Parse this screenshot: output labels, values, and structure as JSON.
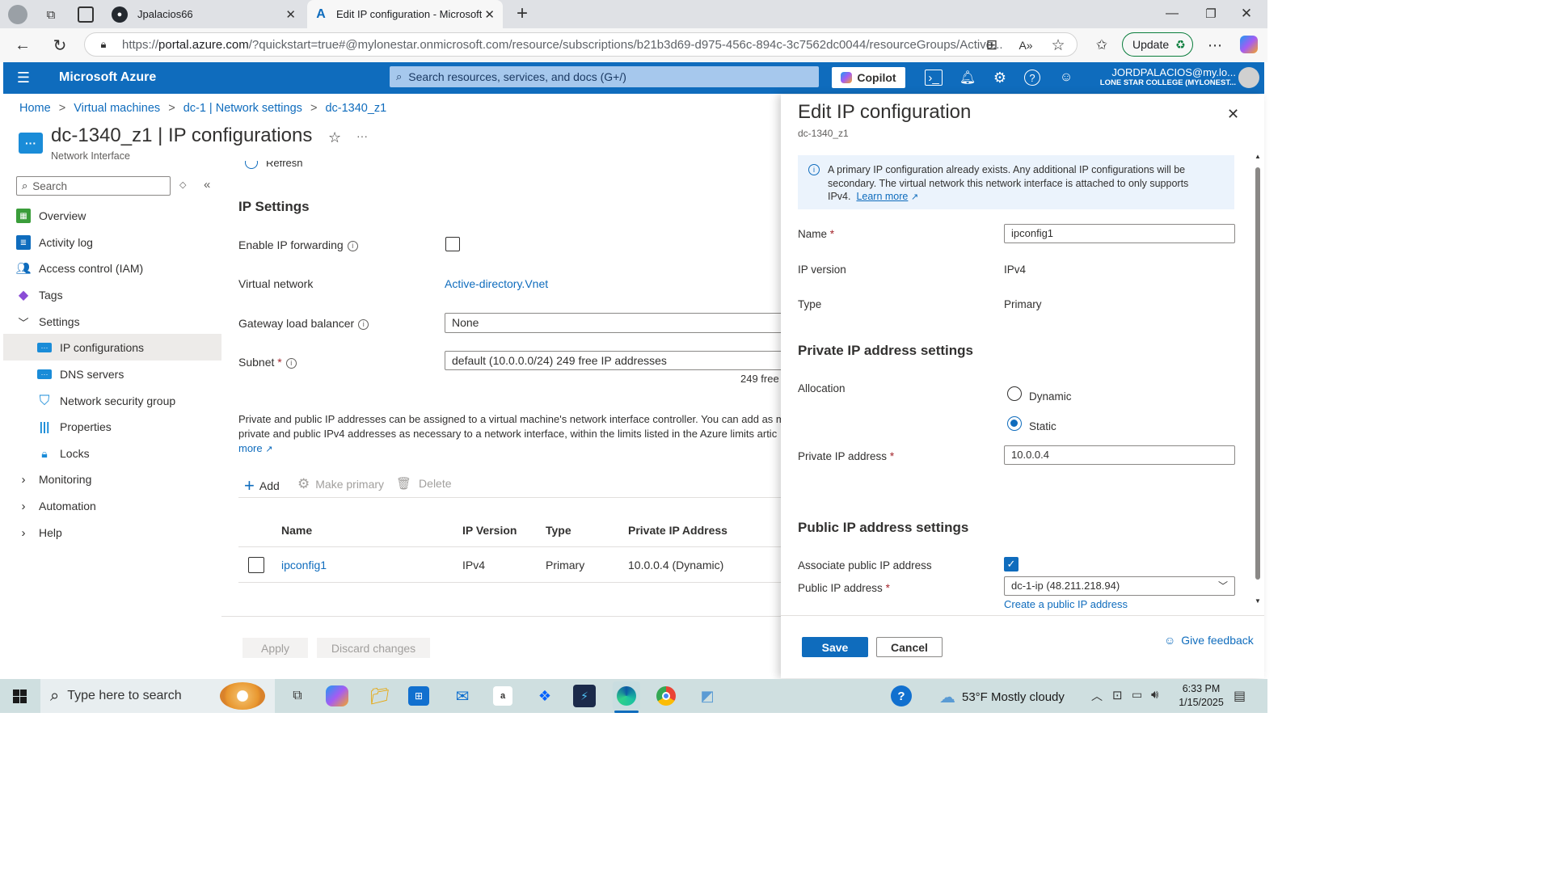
{
  "browser": {
    "tabs": [
      {
        "title": "Jpalacios66"
      },
      {
        "title": "Edit IP configuration - Microsoft A"
      }
    ],
    "url_prefix": "https://",
    "url_domain": "portal.azure.com",
    "url_rest": "/?quickstart=true#@mylonestar.onmicrosoft.com/resource/subscriptions/b21b3d69-d975-456c-894c-3c7562dc0044/resourceGroups/Active...",
    "update_label": "Update"
  },
  "azure_bar": {
    "brand": "Microsoft Azure",
    "search_placeholder": "Search resources, services, and docs (G+/)",
    "copilot_label": "Copilot",
    "user_name": "JORDPALACIOS@my.lo...",
    "user_org": "LONE STAR COLLEGE (MYLONEST..."
  },
  "breadcrumb": [
    "Home",
    "Virtual machines",
    "dc-1 | Network settings",
    "dc-1340_z1"
  ],
  "breadcrumb_sep": ">",
  "page": {
    "title": "dc-1340_z1 | IP configurations",
    "subtitle": "Network Interface",
    "more": "···"
  },
  "sidebar": {
    "search_placeholder": "Search",
    "items": [
      {
        "label": "Overview",
        "icon": "overview-icon"
      },
      {
        "label": "Activity log",
        "icon": "activity-log-icon"
      },
      {
        "label": "Access control (IAM)",
        "icon": "iam-icon"
      },
      {
        "label": "Tags",
        "icon": "tag-icon"
      },
      {
        "label": "Settings",
        "icon": "chevron-down-icon"
      },
      {
        "label": "IP configurations",
        "icon": "nic-icon"
      },
      {
        "label": "DNS servers",
        "icon": "dns-icon"
      },
      {
        "label": "Network security group",
        "icon": "shield-icon"
      },
      {
        "label": "Properties",
        "icon": "properties-icon"
      },
      {
        "label": "Locks",
        "icon": "lock-icon"
      },
      {
        "label": "Monitoring",
        "icon": "chevron-right-icon"
      },
      {
        "label": "Automation",
        "icon": "chevron-right-icon"
      },
      {
        "label": "Help",
        "icon": "chevron-right-icon"
      }
    ]
  },
  "main": {
    "refresh_label": "Refresh",
    "section_title": "IP Settings",
    "enable_forwarding_label": "Enable IP forwarding",
    "vnet_label": "Virtual network",
    "vnet_value": "Active-directory.Vnet",
    "gateway_label": "Gateway load balancer",
    "gateway_value": "None",
    "subnet_label": "Subnet",
    "subnet_value": "default (10.0.0.0/24) 249 free IP addresses",
    "subnet_note": "249 free",
    "description_line1": "Private and public IP addresses can be assigned to a virtual machine's network interface controller. You can add as m",
    "description_line2": "private and public IPv4 addresses as necessary to a network interface, within the limits listed in the Azure limits artic",
    "description_more": "more",
    "toolbar": {
      "add": "Add",
      "make_primary": "Make primary",
      "delete": "Delete"
    },
    "table": {
      "headers": [
        "Name",
        "IP Version",
        "Type",
        "Private IP Address"
      ],
      "rows": [
        {
          "name": "ipconfig1",
          "version": "IPv4",
          "type": "Primary",
          "private_ip": "10.0.0.4 (Dynamic)"
        }
      ]
    },
    "apply_label": "Apply",
    "discard_label": "Discard changes"
  },
  "panel": {
    "title": "Edit IP configuration",
    "subtitle": "dc-1340_z1",
    "info_text_1": "A primary IP configuration already exists. Any additional IP configurations will be",
    "info_text_2": "secondary. The virtual network this network interface is attached to only supports",
    "info_text_3": "IPv4.",
    "learn_more": "Learn more",
    "name_label": "Name",
    "name_value": "ipconfig1",
    "ip_version_label": "IP version",
    "ip_version_value": "IPv4",
    "type_label": "Type",
    "type_value": "Primary",
    "private_section": "Private IP address settings",
    "allocation_label": "Allocation",
    "allocation_options": [
      "Dynamic",
      "Static"
    ],
    "allocation_selected": "Static",
    "private_ip_label": "Private IP address",
    "private_ip_value": "10.0.0.4",
    "public_section": "Public IP address settings",
    "associate_label": "Associate public IP address",
    "public_ip_label": "Public IP address",
    "public_ip_value": "dc-1-ip (48.211.218.94)",
    "create_public_ip": "Create a public IP address",
    "save_label": "Save",
    "cancel_label": "Cancel",
    "feedback_label": "Give feedback",
    "required_mark": "*"
  },
  "taskbar": {
    "search_placeholder": "Type here to search",
    "weather": "53°F  Mostly cloudy",
    "time": "6:33 PM",
    "date": "1/15/2025"
  },
  "colors": {
    "azure_blue": "#0f6cbd",
    "link": "#0f6cbd",
    "info_bg": "#ebf3fc",
    "taskbar": "#cfdfe0"
  }
}
